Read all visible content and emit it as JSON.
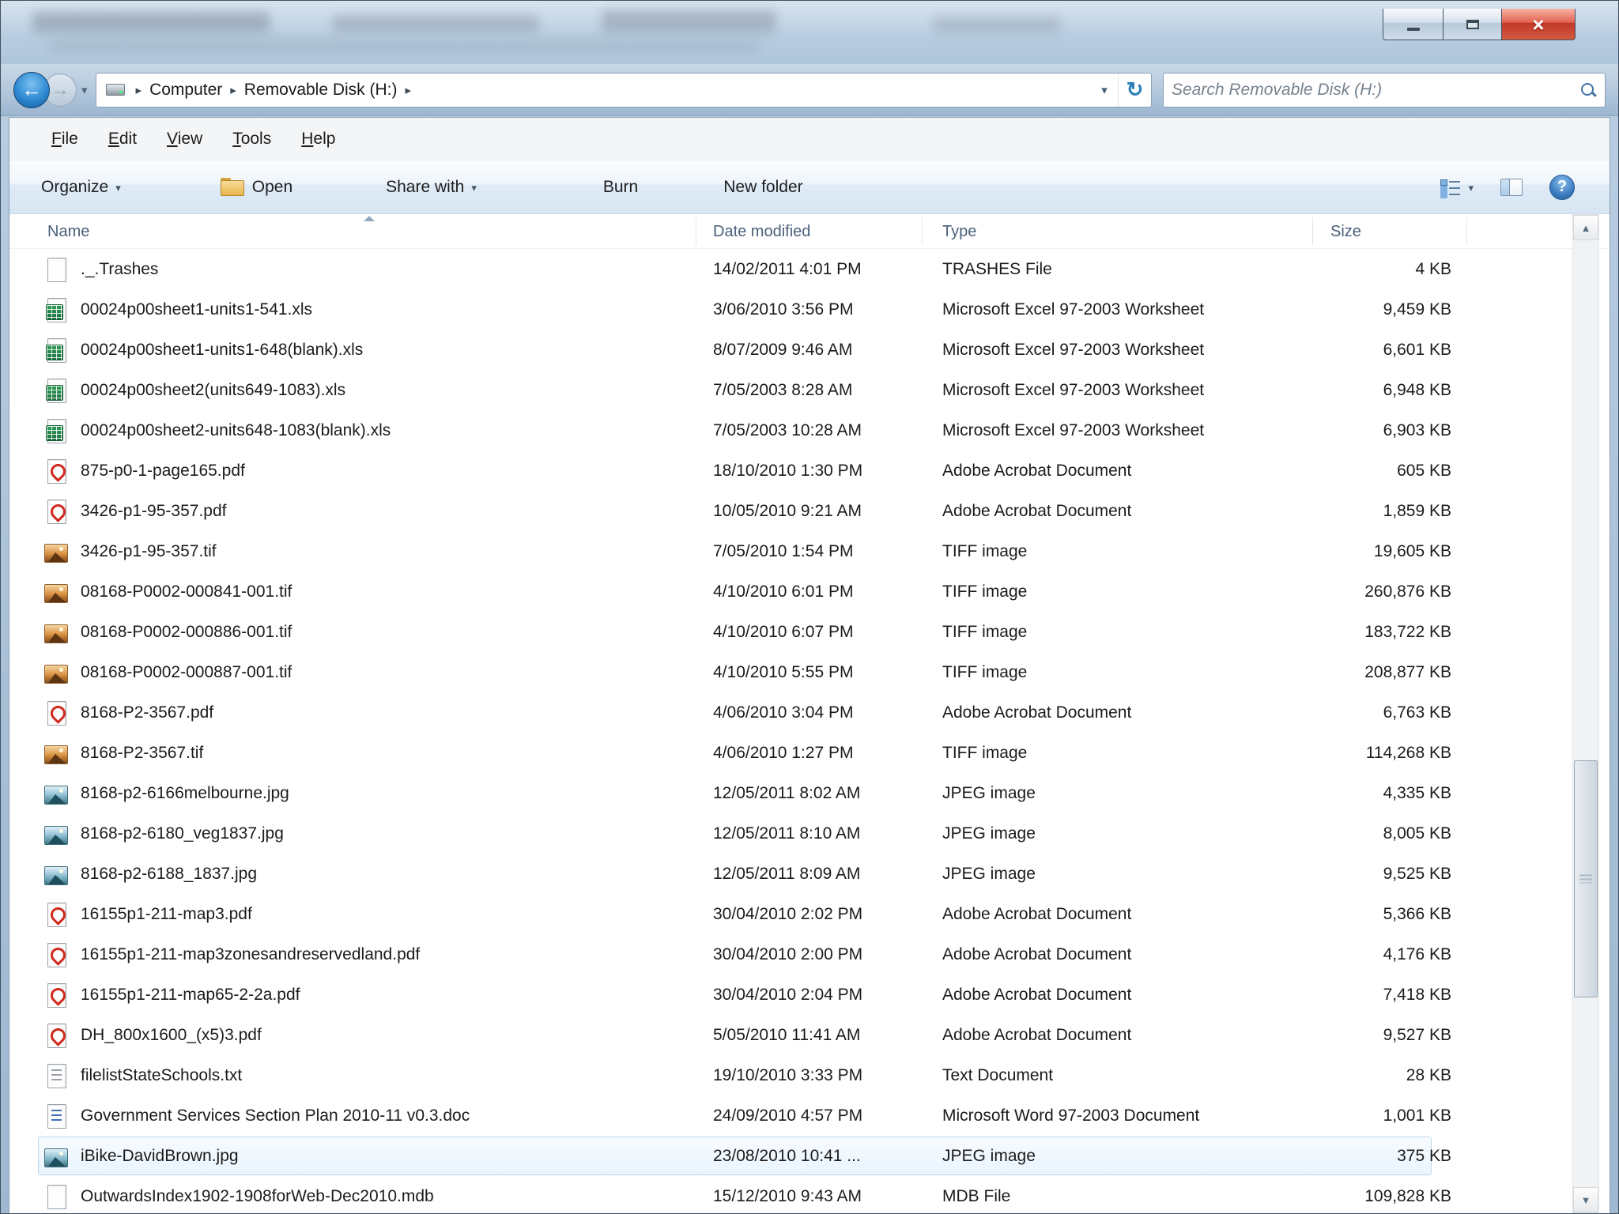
{
  "window": {
    "caption": {
      "minimize": "minimize",
      "maximize": "maximize",
      "close": "close"
    }
  },
  "nav": {
    "breadcrumb": {
      "items": [
        "Computer",
        "Removable Disk (H:)"
      ]
    },
    "search": {
      "placeholder": "Search Removable Disk (H:)"
    }
  },
  "menu": {
    "items": [
      "File",
      "Edit",
      "View",
      "Tools",
      "Help"
    ]
  },
  "toolbar": {
    "organize": "Organize",
    "open": "Open",
    "share_with": "Share with",
    "burn": "Burn",
    "new_folder": "New folder"
  },
  "columns": [
    "Name",
    "Date modified",
    "Type",
    "Size"
  ],
  "files": [
    {
      "name": "._.Trashes",
      "date": "14/02/2011 4:01 PM",
      "type": "TRASHES File",
      "size": "4 KB",
      "icon": "generic"
    },
    {
      "name": "00024p00sheet1-units1-541.xls",
      "date": "3/06/2010 3:56 PM",
      "type": "Microsoft Excel 97-2003 Worksheet",
      "size": "9,459 KB",
      "icon": "excel"
    },
    {
      "name": "00024p00sheet1-units1-648(blank).xls",
      "date": "8/07/2009 9:46 AM",
      "type": "Microsoft Excel 97-2003 Worksheet",
      "size": "6,601 KB",
      "icon": "excel"
    },
    {
      "name": "00024p00sheet2(units649-1083).xls",
      "date": "7/05/2003 8:28 AM",
      "type": "Microsoft Excel 97-2003 Worksheet",
      "size": "6,948 KB",
      "icon": "excel"
    },
    {
      "name": "00024p00sheet2-units648-1083(blank).xls",
      "date": "7/05/2003 10:28 AM",
      "type": "Microsoft Excel 97-2003 Worksheet",
      "size": "6,903 KB",
      "icon": "excel"
    },
    {
      "name": "875-p0-1-page165.pdf",
      "date": "18/10/2010 1:30 PM",
      "type": "Adobe Acrobat Document",
      "size": "605 KB",
      "icon": "pdf"
    },
    {
      "name": "3426-p1-95-357.pdf",
      "date": "10/05/2010 9:21 AM",
      "type": "Adobe Acrobat Document",
      "size": "1,859 KB",
      "icon": "pdf"
    },
    {
      "name": "3426-p1-95-357.tif",
      "date": "7/05/2010 1:54 PM",
      "type": "TIFF image",
      "size": "19,605 KB",
      "icon": "tiff"
    },
    {
      "name": "08168-P0002-000841-001.tif",
      "date": "4/10/2010 6:01 PM",
      "type": "TIFF image",
      "size": "260,876 KB",
      "icon": "tiff"
    },
    {
      "name": "08168-P0002-000886-001.tif",
      "date": "4/10/2010 6:07 PM",
      "type": "TIFF image",
      "size": "183,722 KB",
      "icon": "tiff"
    },
    {
      "name": "08168-P0002-000887-001.tif",
      "date": "4/10/2010 5:55 PM",
      "type": "TIFF image",
      "size": "208,877 KB",
      "icon": "tiff"
    },
    {
      "name": "8168-P2-3567.pdf",
      "date": "4/06/2010 3:04 PM",
      "type": "Adobe Acrobat Document",
      "size": "6,763 KB",
      "icon": "pdf"
    },
    {
      "name": "8168-P2-3567.tif",
      "date": "4/06/2010 1:27 PM",
      "type": "TIFF image",
      "size": "114,268 KB",
      "icon": "tiff"
    },
    {
      "name": "8168-p2-6166melbourne.jpg",
      "date": "12/05/2011 8:02 AM",
      "type": "JPEG image",
      "size": "4,335 KB",
      "icon": "jpeg"
    },
    {
      "name": "8168-p2-6180_veg1837.jpg",
      "date": "12/05/2011 8:10 AM",
      "type": "JPEG image",
      "size": "8,005 KB",
      "icon": "jpeg"
    },
    {
      "name": "8168-p2-6188_1837.jpg",
      "date": "12/05/2011 8:09 AM",
      "type": "JPEG image",
      "size": "9,525 KB",
      "icon": "jpeg"
    },
    {
      "name": "16155p1-211-map3.pdf",
      "date": "30/04/2010 2:02 PM",
      "type": "Adobe Acrobat Document",
      "size": "5,366 KB",
      "icon": "pdf"
    },
    {
      "name": "16155p1-211-map3zonesandreservedland.pdf",
      "date": "30/04/2010 2:00 PM",
      "type": "Adobe Acrobat Document",
      "size": "4,176 KB",
      "icon": "pdf"
    },
    {
      "name": "16155p1-211-map65-2-2a.pdf",
      "date": "30/04/2010 2:04 PM",
      "type": "Adobe Acrobat Document",
      "size": "7,418 KB",
      "icon": "pdf"
    },
    {
      "name": "DH_800x1600_(x5)3.pdf",
      "date": "5/05/2010 11:41 AM",
      "type": "Adobe Acrobat Document",
      "size": "9,527 KB",
      "icon": "pdf"
    },
    {
      "name": "filelistStateSchools.txt",
      "date": "19/10/2010 3:33 PM",
      "type": "Text Document",
      "size": "28 KB",
      "icon": "txt"
    },
    {
      "name": "Government Services Section Plan 2010-11 v0.3.doc",
      "date": "24/09/2010 4:57 PM",
      "type": "Microsoft Word 97-2003 Document",
      "size": "1,001 KB",
      "icon": "doc"
    },
    {
      "name": "iBike-DavidBrown.jpg",
      "date": "23/08/2010 10:41 ...",
      "type": "JPEG image",
      "size": "375 KB",
      "icon": "jpeg",
      "highlighted": true
    },
    {
      "name": "OutwardsIndex1902-1908forWeb-Dec2010.mdb",
      "date": "15/12/2010 9:43 AM",
      "type": "MDB File",
      "size": "109,828 KB",
      "icon": "generic"
    }
  ],
  "colors": {
    "accent_blue": "#2e8ad2",
    "close_red": "#c0392a",
    "header_text": "#49607b",
    "highlight_border": "#b8d8f1"
  }
}
